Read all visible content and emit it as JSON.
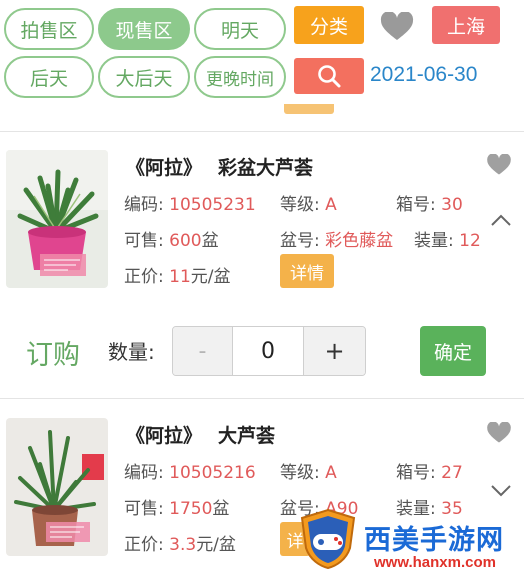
{
  "filters": {
    "auction": "拍售区",
    "spot": "现售区",
    "tomorrow": "明天",
    "day_after": "后天",
    "two_days_after": "大后天",
    "later": "更晚时间"
  },
  "toolbar": {
    "category": "分类",
    "city": "上海",
    "date": "2021-06-30"
  },
  "products": [
    {
      "title_prefix": "《阿拉》",
      "name": "彩盆大芦荟",
      "code_label": "编码:",
      "code": "10505231",
      "grade_label": "等级:",
      "grade": "A",
      "box_label": "箱号:",
      "box": "30",
      "avail_label": "可售:",
      "avail": "600",
      "avail_unit": "盆",
      "pot_label": "盆号:",
      "pot": "彩色藤盆",
      "pack_label": "装量:",
      "pack": "12",
      "price_label": "正价:",
      "price": "11",
      "price_unit": "元/盆",
      "detail": "详情"
    },
    {
      "title_prefix": "《阿拉》",
      "name": "大芦荟",
      "code_label": "编码:",
      "code": "10505216",
      "grade_label": "等级:",
      "grade": "A",
      "box_label": "箱号:",
      "box": "27",
      "avail_label": "可售:",
      "avail": "1750",
      "avail_unit": "盆",
      "pot_label": "盆号:",
      "pot": "A90",
      "pack_label": "装量:",
      "pack": "35",
      "price_label": "正价:",
      "price": "3.3",
      "price_unit": "元/盆",
      "detail": "详"
    }
  ],
  "order": {
    "label": "订购",
    "qty_label": "数量:",
    "minus": "-",
    "qty": "0",
    "plus": "+",
    "confirm": "确定"
  },
  "watermark": {
    "text": "西美手游网",
    "url": "www.hanxm.com"
  },
  "colors": {
    "accent_green": "#8dc98c",
    "orange": "#f7a21c",
    "red": "#f0706f",
    "date_blue": "#2a86c9",
    "value_red": "#e05a5a"
  },
  "icons": [
    "heart-icon",
    "search-icon",
    "chevron-up-icon",
    "chevron-down-icon",
    "plant-photo"
  ]
}
